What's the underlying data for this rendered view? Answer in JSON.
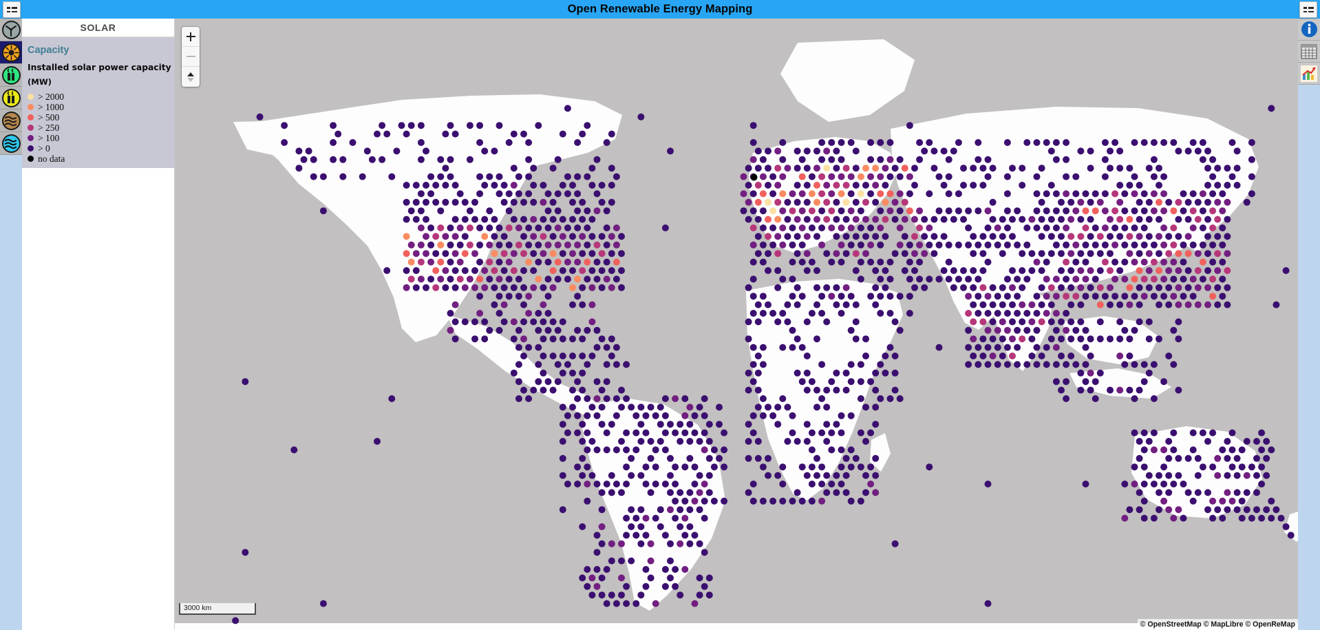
{
  "app": {
    "title": "Open Renewable Energy Mapping",
    "titlebar_color": "#28a6f5"
  },
  "menu": {
    "left_button_name": "main-menu",
    "right_button_name": "panel-menu"
  },
  "left_rail": {
    "items": [
      {
        "id": "wind",
        "label": "Wind",
        "icon": "wind-turbine-icon",
        "selected": false,
        "circle_color": "#9aa5a5"
      },
      {
        "id": "solar",
        "label": "Solar",
        "icon": "sun-icon",
        "selected": true,
        "circle_color": "#f5a31e"
      },
      {
        "id": "bioenergy",
        "label": "Bioenergy",
        "icon": "biomass-green-icon",
        "selected": false,
        "circle_color": "#2ce57f"
      },
      {
        "id": "biogas",
        "label": "Biogas",
        "icon": "biomass-yellow-icon",
        "selected": false,
        "circle_color": "#ebe817"
      },
      {
        "id": "geothermal",
        "label": "Geothermal",
        "icon": "geothermal-icon",
        "selected": false,
        "circle_color": "#b5884f"
      },
      {
        "id": "hydro",
        "label": "Hydro",
        "icon": "hydro-water-icon",
        "selected": false,
        "circle_color": "#2ec8ef"
      }
    ]
  },
  "right_rail": {
    "items": [
      {
        "id": "info",
        "label": "Information",
        "icon": "info-circle-icon"
      },
      {
        "id": "table",
        "label": "Data table",
        "icon": "table-icon"
      },
      {
        "id": "chart",
        "label": "Statistics",
        "icon": "bar-chart-icon"
      }
    ]
  },
  "panel": {
    "header": "SOLAR",
    "subtitle": "Capacity",
    "description": "Installed solar power capacity",
    "unit": "(MW)",
    "legend": [
      {
        "label": "> 2000",
        "color": "#fcdfa2"
      },
      {
        "label": "> 1000",
        "color": "#fb8b61"
      },
      {
        "label": "> 500",
        "color": "#f1605d"
      },
      {
        "label": "> 250",
        "color": "#b63779"
      },
      {
        "label": "> 100",
        "color": "#721f81"
      },
      {
        "label": "> 0",
        "color": "#3b0f70"
      },
      {
        "label": "no data",
        "color": "#000000"
      }
    ]
  },
  "map": {
    "ocean_color": "#c2c0c0",
    "land_color": "#fdfdfd",
    "scale_label": "3000 km",
    "attribution": "© OpenStreetMap © MapLibre © OpenReMap",
    "controls": {
      "zoom_in": "+",
      "zoom_out": "−",
      "compass": "compass-icon"
    }
  }
}
